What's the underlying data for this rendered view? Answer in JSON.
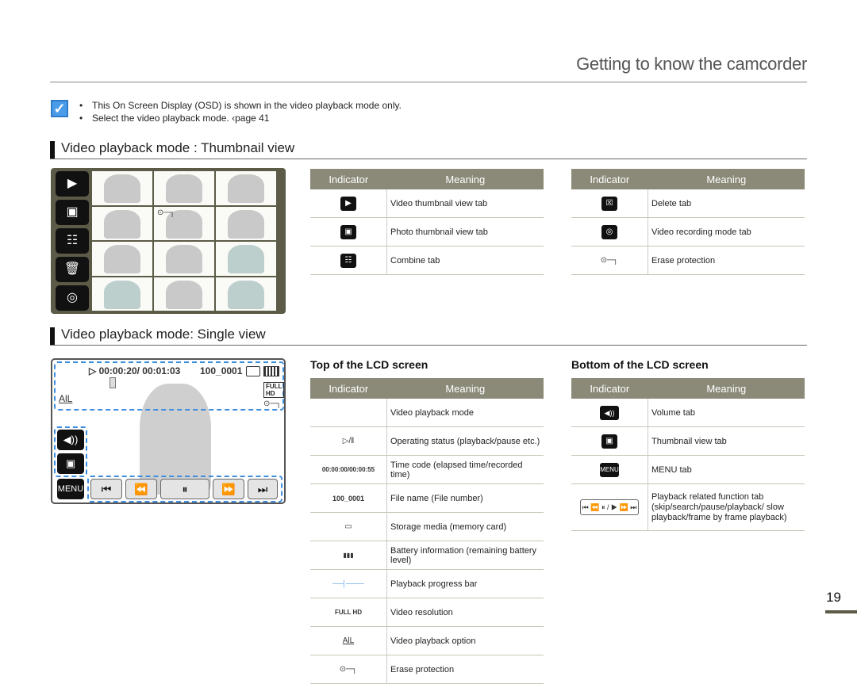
{
  "header": {
    "title": "Getting to know the camcorder"
  },
  "note": {
    "icon": "check-note-icon",
    "items": [
      "This On Screen Display (OSD) is shown in the video playback mode only.",
      "Select the video playback mode. ‹page 41"
    ]
  },
  "thumbnail_section": {
    "heading": "Video playback mode : Thumbnail view",
    "screen_tabs": [
      "video-thumbnail-tab",
      "photo-thumbnail-tab",
      "combine-tab",
      "delete-tab",
      "video-recording-tab"
    ],
    "table_left": {
      "headers": [
        "Indicator",
        "Meaning"
      ],
      "rows": [
        {
          "icon": "video-thumbnail-view-icon",
          "glyph": "▶",
          "meaning": "Video thumbnail view tab"
        },
        {
          "icon": "photo-thumbnail-view-icon",
          "glyph": "▣",
          "meaning": "Photo thumbnail view tab"
        },
        {
          "icon": "combine-icon",
          "glyph": "☷",
          "meaning": "Combine tab"
        }
      ]
    },
    "table_right": {
      "headers": [
        "Indicator",
        "Meaning"
      ],
      "rows": [
        {
          "icon": "delete-icon",
          "glyph": "☒",
          "meaning": "Delete tab"
        },
        {
          "icon": "video-recording-icon",
          "glyph": "◎",
          "meaning": "Video recording mode tab"
        },
        {
          "icon": "erase-protection-key-icon",
          "glyph": "⊙─┐",
          "meaning": "Erase protection"
        }
      ]
    }
  },
  "single_section": {
    "heading": "Video playback mode: Single view",
    "osd": {
      "status": "▷",
      "timecode": "00:00:20/ 00:01:03",
      "file": "100_0001",
      "option": "AlL",
      "resolution": "FULL HD",
      "menu": "MENU",
      "progress": 0.32
    },
    "top_heading": "Top of the LCD screen",
    "top_table": {
      "headers": [
        "Indicator",
        "Meaning"
      ],
      "rows": [
        {
          "icon": "",
          "glyph": "",
          "meaning": "Video playback mode"
        },
        {
          "icon": "play-pause-status-icon",
          "glyph": "▷/‖",
          "meaning": "Operating status (playback/pause etc.)"
        },
        {
          "icon": "timecode-icon",
          "glyph": "00:00:00/00:00:55",
          "meaning": "Time code (elapsed time/recorded time)"
        },
        {
          "icon": "file-name-icon",
          "glyph": "100_0001",
          "meaning": "File name (File number)"
        },
        {
          "icon": "memory-card-icon",
          "glyph": "▭",
          "meaning": "Storage media (memory card)"
        },
        {
          "icon": "battery-icon",
          "glyph": "▮▮▮",
          "meaning": "Battery information (remaining battery level)"
        },
        {
          "icon": "progress-bar-icon",
          "glyph": "──┤────",
          "meaning": "Playback progress bar"
        },
        {
          "icon": "full-hd-icon",
          "glyph": "FULL HD",
          "meaning": "Video resolution"
        },
        {
          "icon": "playback-option-all-icon",
          "glyph": "AlL",
          "meaning": "Video playback option"
        },
        {
          "icon": "erase-protection-key-icon",
          "glyph": "⊙─┐",
          "meaning": "Erase protection"
        }
      ]
    },
    "bottom_heading": "Bottom of the LCD screen",
    "bottom_table": {
      "headers": [
        "Indicator",
        "Meaning"
      ],
      "rows": [
        {
          "icon": "volume-icon",
          "glyph": "◀))",
          "meaning": "Volume tab"
        },
        {
          "icon": "thumbnail-view-icon",
          "glyph": "▣",
          "meaning": "Thumbnail view tab"
        },
        {
          "icon": "menu-icon",
          "glyph": "MENU",
          "meaning": "MENU tab"
        },
        {
          "icon": "playback-function-icons",
          "glyph": "⏮ ⏪ ⏸ / ▶ ⏩ ⏭",
          "meaning": "Playback related function tab (skip/search/pause/playback/ slow playback/frame by frame playback)"
        }
      ]
    }
  },
  "footer": {
    "page_number": "19"
  }
}
